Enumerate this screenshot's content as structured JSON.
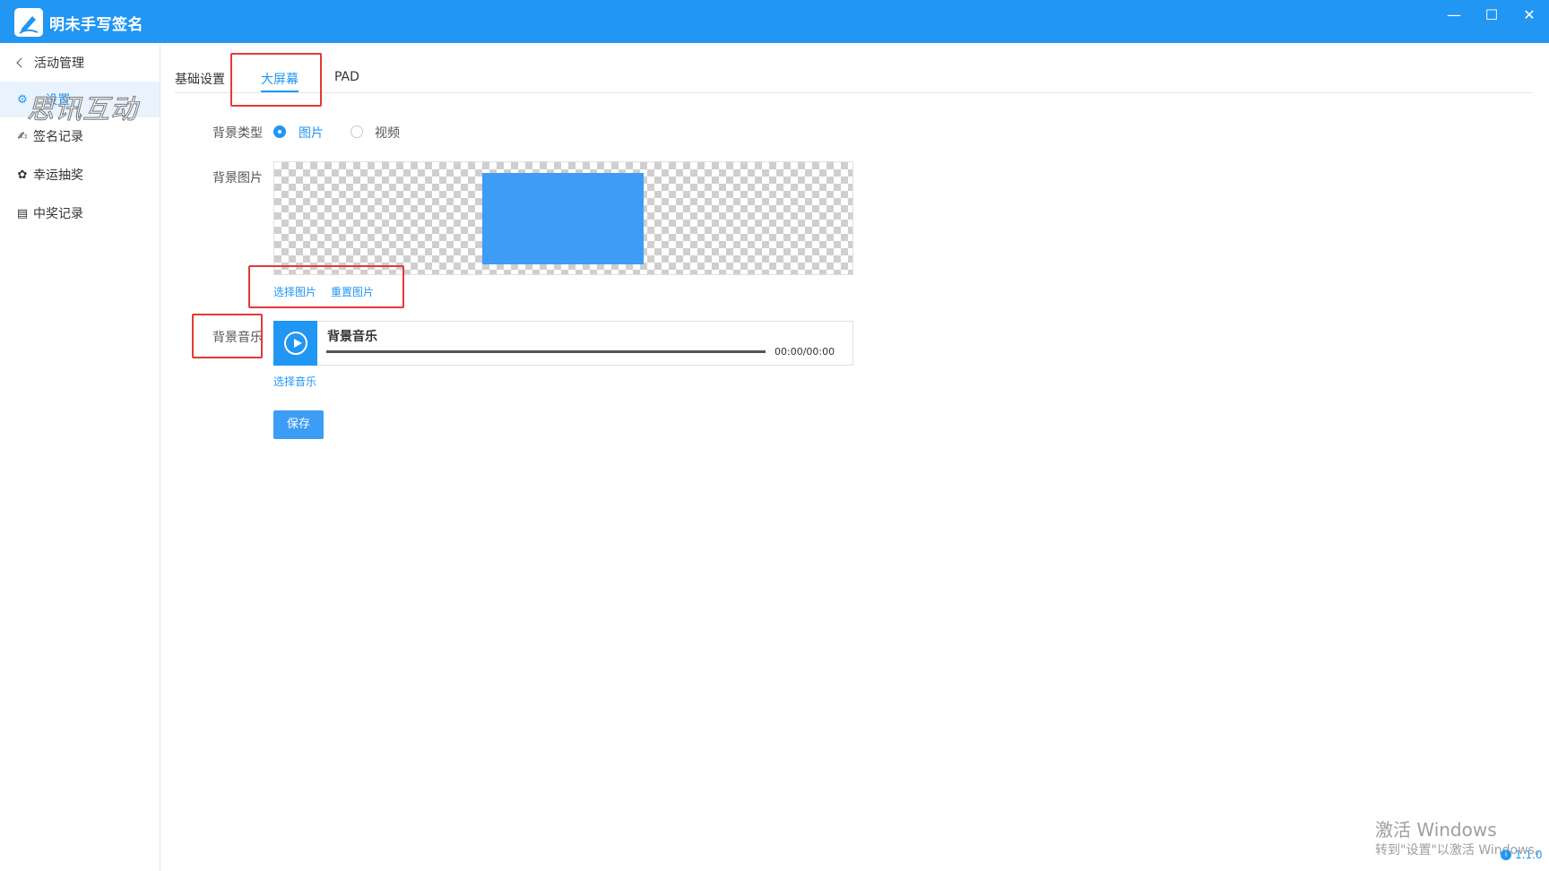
{
  "window": {
    "title": "明未手写签名",
    "minimize": "—",
    "maximize": "☐",
    "close": "✕"
  },
  "sidebar": {
    "back_label": "活动管理",
    "watermark": "思讯互动",
    "items": [
      {
        "label": "...设置",
        "icon": "gear-icon",
        "active": true
      },
      {
        "label": "签名记录",
        "icon": "signature-icon",
        "active": false
      },
      {
        "label": "幸运抽奖",
        "icon": "lottery-icon",
        "active": false
      },
      {
        "label": "中奖记录",
        "icon": "record-icon",
        "active": false
      }
    ]
  },
  "tabs": [
    {
      "label": "基础设置",
      "active": false
    },
    {
      "label": "大屏幕",
      "active": true
    },
    {
      "label": "PAD",
      "active": false
    }
  ],
  "form": {
    "bg_type_label": "背景类型",
    "bg_type_options": [
      {
        "label": "图片",
        "checked": true
      },
      {
        "label": "视频",
        "checked": false
      }
    ],
    "bg_image_label": "背景图片",
    "select_image": "选择图片",
    "reset_image": "重置图片",
    "bg_music_label": "背景音乐",
    "music_title": "背景音乐",
    "music_time": "00:00/00:00",
    "select_music": "选择音乐",
    "save": "保存"
  },
  "footer": {
    "activate_line1": "激活 Windows",
    "activate_line2": "转到\"设置\"以激活 Windows。",
    "version": "1.1.0"
  },
  "colors": {
    "accent": "#2196f3",
    "annotation": "#e53935"
  }
}
